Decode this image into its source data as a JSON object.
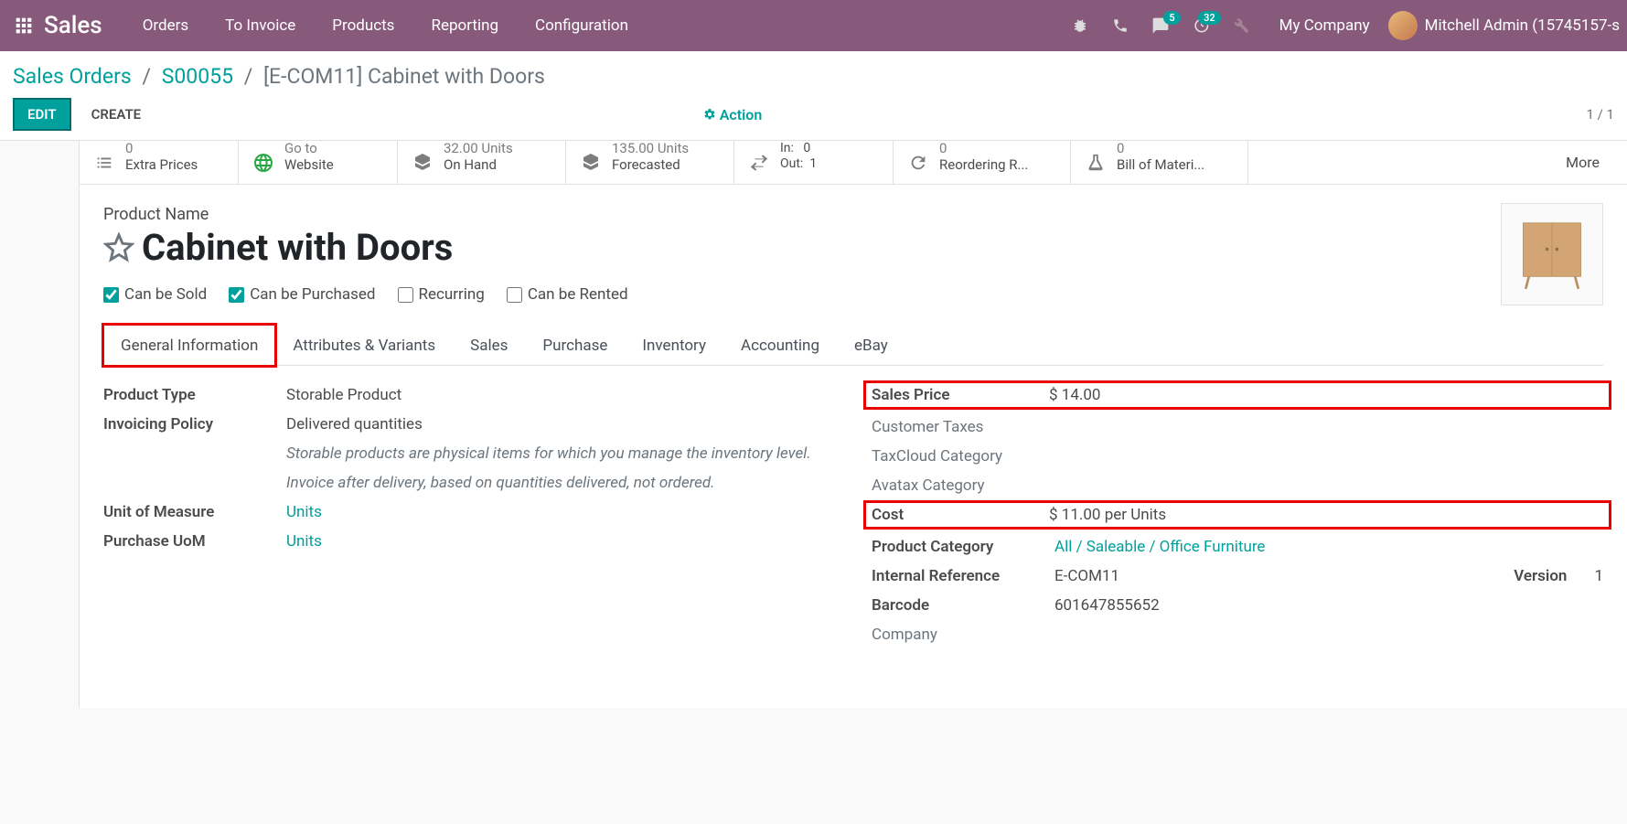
{
  "topnav": {
    "brand": "Sales",
    "items": [
      "Orders",
      "To Invoice",
      "Products",
      "Reporting",
      "Configuration"
    ],
    "messages_badge": "5",
    "activities_badge": "32",
    "company": "My Company",
    "user": "Mitchell Admin (15745157-s"
  },
  "breadcrumb": {
    "a": "Sales Orders",
    "b": "S00055",
    "c": "[E-COM11] Cabinet with Doors"
  },
  "toolbar": {
    "edit": "EDIT",
    "create": "CREATE",
    "action": "Action",
    "pager": "1 / 1"
  },
  "stats": {
    "extra_prices_num": "0",
    "extra_prices": "Extra Prices",
    "website_top": "Go to",
    "website": "Website",
    "onhand_num": "32.00 Units",
    "onhand": "On Hand",
    "forecast_num": "135.00 Units",
    "forecast": "Forecasted",
    "in_label": "In:",
    "in_val": "0",
    "out_label": "Out:",
    "out_val": "1",
    "reorder_num": "0",
    "reorder": "Reordering R...",
    "bom_num": "0",
    "bom": "Bill of Materi...",
    "more": "More"
  },
  "product": {
    "name_label": "Product Name",
    "name": "Cabinet with Doors",
    "can_be_sold": "Can be Sold",
    "can_be_purchased": "Can be Purchased",
    "recurring": "Recurring",
    "can_be_rented": "Can be Rented"
  },
  "tabs": [
    "General Information",
    "Attributes & Variants",
    "Sales",
    "Purchase",
    "Inventory",
    "Accounting",
    "eBay"
  ],
  "fields": {
    "product_type_l": "Product Type",
    "product_type": "Storable Product",
    "invoicing_policy_l": "Invoicing Policy",
    "invoicing_policy": "Delivered quantities",
    "help1": "Storable products are physical items for which you manage the inventory level.",
    "help2": "Invoice after delivery, based on quantities delivered, not ordered.",
    "uom_l": "Unit of Measure",
    "uom": "Units",
    "puom_l": "Purchase UoM",
    "puom": "Units",
    "sales_price_l": "Sales Price",
    "sales_price": "$ 14.00",
    "cust_taxes_l": "Customer Taxes",
    "taxcloud_l": "TaxCloud Category",
    "avatax_l": "Avatax Category",
    "cost_l": "Cost",
    "cost": "$ 11.00",
    "cost_unit": "per Units",
    "category_l": "Product Category",
    "category": "All / Saleable / Office Furniture",
    "iref_l": "Internal Reference",
    "iref": "E-COM11",
    "version_l": "Version",
    "version": "1",
    "barcode_l": "Barcode",
    "barcode": "601647855652",
    "company_l": "Company"
  }
}
